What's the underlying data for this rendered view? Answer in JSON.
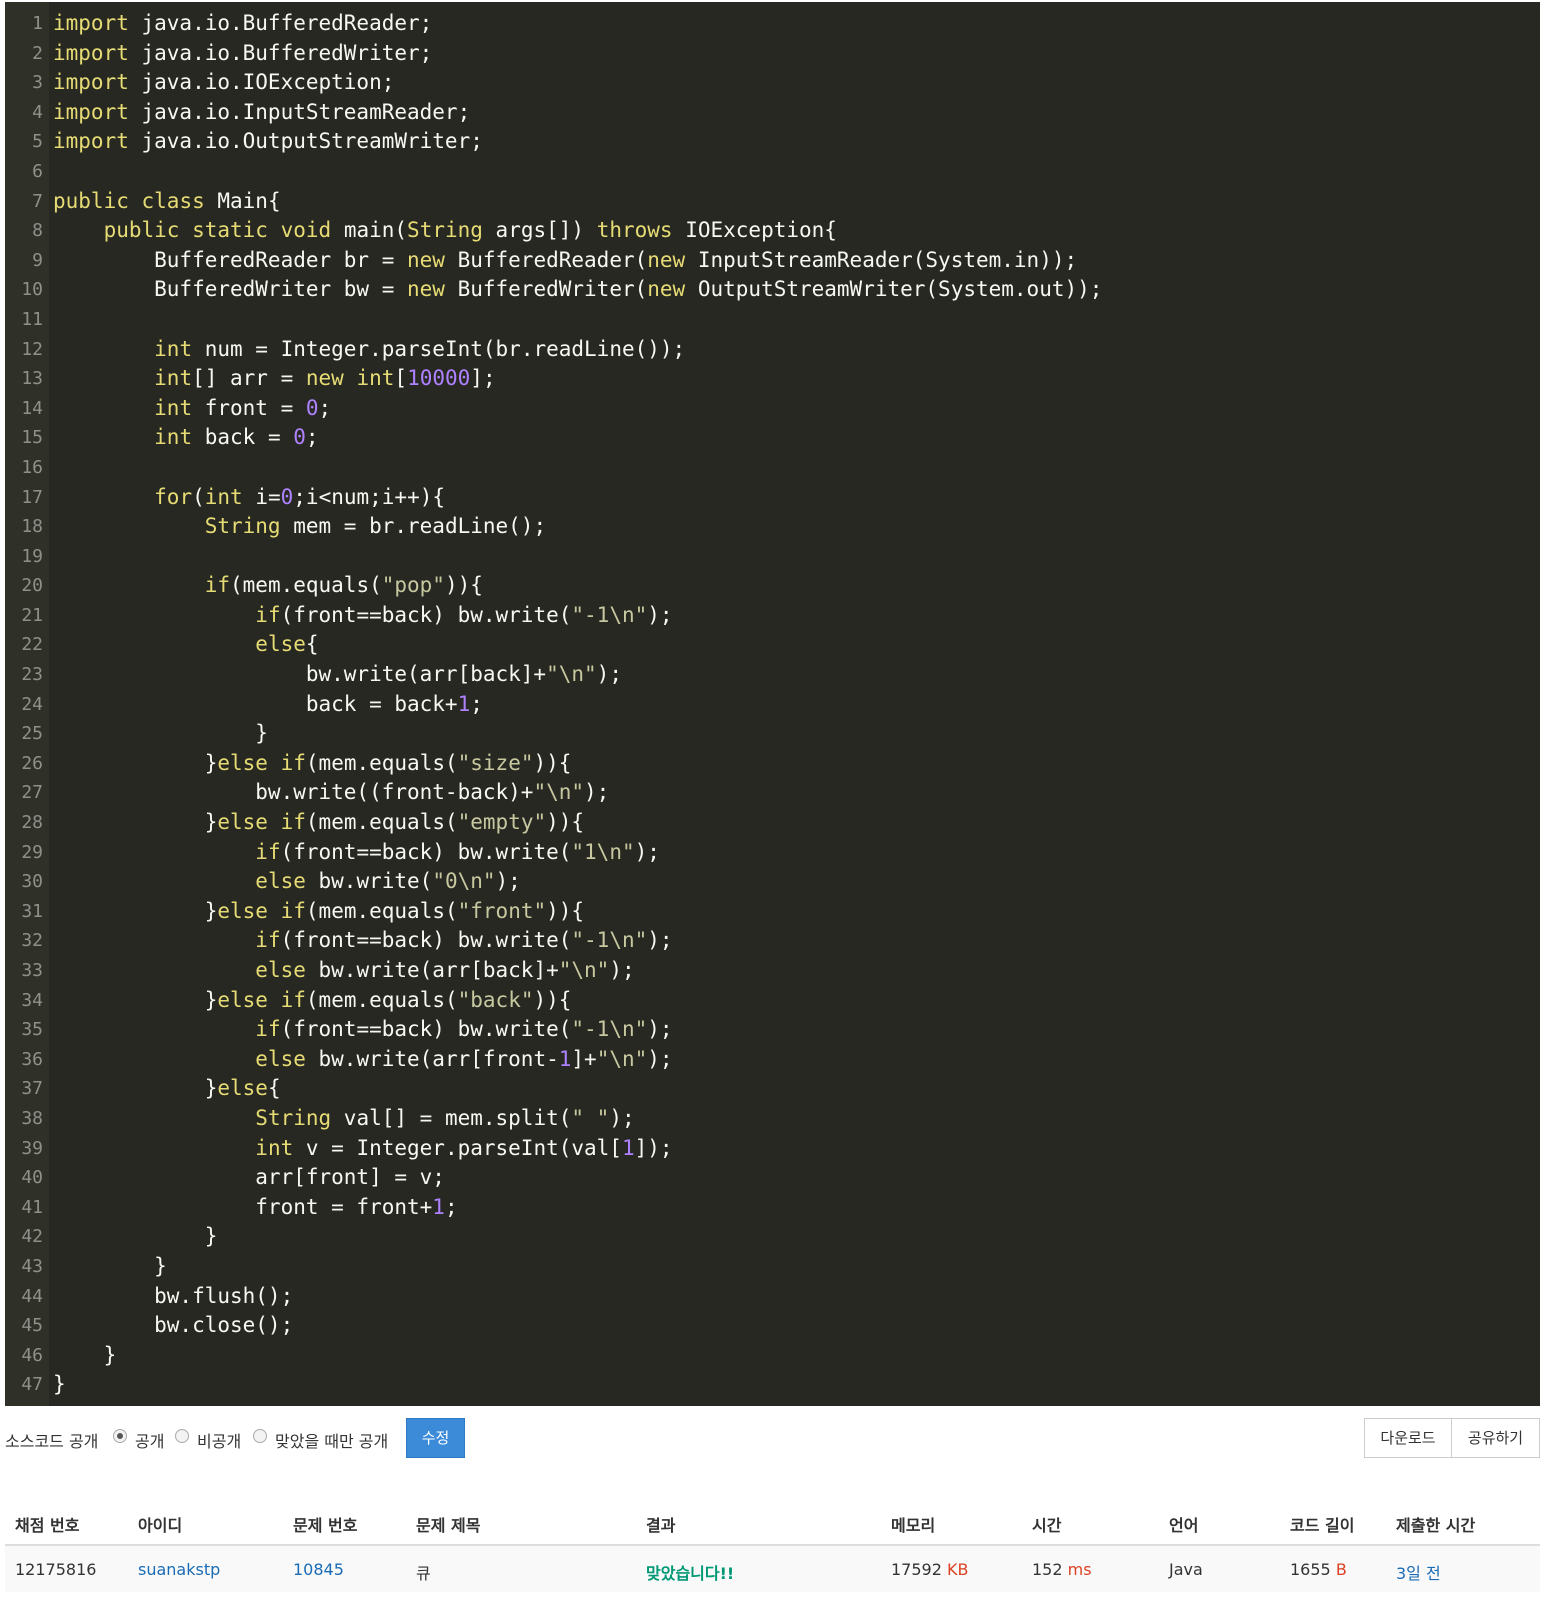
{
  "code": {
    "lines": [
      "import java.io.BufferedReader;",
      "import java.io.BufferedWriter;",
      "import java.io.IOException;",
      "import java.io.InputStreamReader;",
      "import java.io.OutputStreamWriter;",
      "",
      "public class Main{",
      "    public static void main(String args[]) throws IOException{",
      "        BufferedReader br = new BufferedReader(new InputStreamReader(System.in));",
      "        BufferedWriter bw = new BufferedWriter(new OutputStreamWriter(System.out));",
      "",
      "        int num = Integer.parseInt(br.readLine());",
      "        int[] arr = new int[10000];",
      "        int front = 0;",
      "        int back = 0;",
      "",
      "        for(int i=0;i<num;i++){",
      "            String mem = br.readLine();",
      "",
      "            if(mem.equals(\"pop\")){",
      "                if(front==back) bw.write(\"-1\\n\");",
      "                else{",
      "                    bw.write(arr[back]+\"\\n\");",
      "                    back = back+1;",
      "                }",
      "            }else if(mem.equals(\"size\")){",
      "                bw.write((front-back)+\"\\n\");",
      "            }else if(mem.equals(\"empty\")){",
      "                if(front==back) bw.write(\"1\\n\");",
      "                else bw.write(\"0\\n\");",
      "            }else if(mem.equals(\"front\")){",
      "                if(front==back) bw.write(\"-1\\n\");",
      "                else bw.write(arr[back]+\"\\n\");",
      "            }else if(mem.equals(\"back\")){",
      "                if(front==back) bw.write(\"-1\\n\");",
      "                else bw.write(arr[front-1]+\"\\n\");",
      "            }else{",
      "                String val[] = mem.split(\" \");",
      "                int v = Integer.parseInt(val[1]);",
      "                arr[front] = v;",
      "                front = front+1;",
      "            }",
      "        }",
      "        bw.flush();",
      "        bw.close();",
      "    }",
      "}"
    ],
    "colors": {
      "background": "#272822",
      "text": "#f8f8f2",
      "keyword": "#e6db74",
      "number": "#ae81ff",
      "string": "#c8c8a0"
    }
  },
  "controls": {
    "source_public_label": "소스코드 공개",
    "options": [
      "공개",
      "비공개",
      "맞았을 때만 공개"
    ],
    "selected_option": "공개",
    "edit_label": "수정",
    "download_label": "다운로드",
    "share_label": "공유하기"
  },
  "table": {
    "headers": [
      "채점 번호",
      "아이디",
      "문제 번호",
      "문제 제목",
      "결과",
      "메모리",
      "시간",
      "언어",
      "코드 길이",
      "제출한 시간"
    ],
    "row": {
      "submission_id": "12175816",
      "user_id": "suanakstp",
      "problem_id": "10845",
      "problem_title": "큐",
      "result": "맞았습니다!!",
      "memory": "17592",
      "memory_unit": "KB",
      "time": "152",
      "time_unit": "ms",
      "language": "Java",
      "code_length": "1655",
      "code_length_unit": "B",
      "submitted": "3일 전"
    }
  }
}
